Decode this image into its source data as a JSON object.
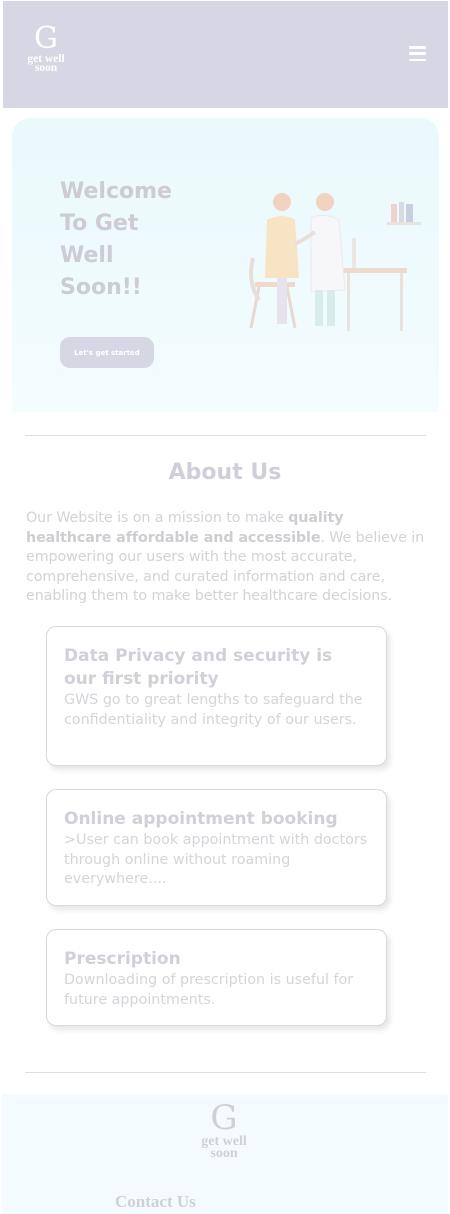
{
  "brand": {
    "logo_letter": "G",
    "logo_text_line1": "get well",
    "logo_text_line2": "soon"
  },
  "header": {
    "menu_icon": "hamburger-menu-icon"
  },
  "hero": {
    "title_lines": [
      "Welcome",
      "To Get",
      "Well",
      "Soon!!"
    ],
    "cta_label": "Let's get started",
    "illustration": "doctor-patient-illustration"
  },
  "about": {
    "title": "About Us",
    "text_before": "Our Website is on a mission to make ",
    "text_bold": "quality healthcare affordable and accessible",
    "text_after": ". We believe in empowering our users with the most accurate, comprehensive, and curated information and care, enabling them to make better healthcare decisions."
  },
  "cards": [
    {
      "title": "Data Privacy and security is our first priority",
      "text": "GWS go to great lengths to safeguard the confidentiality and integrity of our users."
    },
    {
      "title": "Online appointment booking",
      "text": ">User can book appointment with doctors through online without roaming everywhere...."
    },
    {
      "title": "Prescription",
      "text": "Downloading of prescription is useful for future appointments."
    }
  ],
  "footer": {
    "logo_letter": "G",
    "logo_text_line1": "get well",
    "logo_text_line2": "soon",
    "contact_heading": "Contact Us"
  },
  "colors": {
    "header_bg": "#d7d6e4",
    "hero_bg": "#e9f9fc",
    "footer_bg": "#f3fbfe"
  }
}
